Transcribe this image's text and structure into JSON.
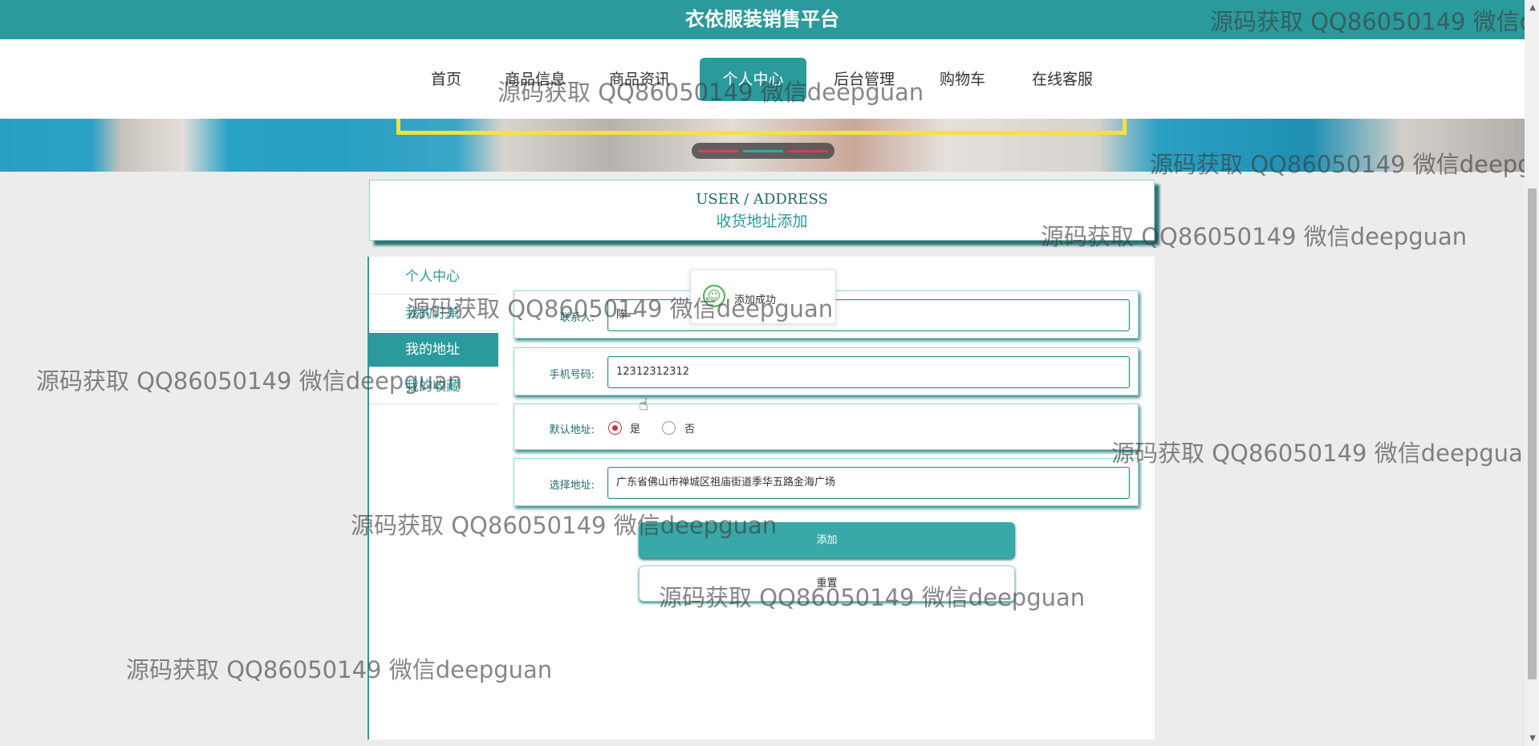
{
  "site": {
    "title": "衣依服装销售平台"
  },
  "nav": {
    "items": [
      {
        "label": "首页"
      },
      {
        "label": "商品信息"
      },
      {
        "label": "商品资讯"
      },
      {
        "label": "个人中心"
      },
      {
        "label": "后台管理"
      },
      {
        "label": "购物车"
      },
      {
        "label": "在线客服"
      }
    ],
    "active": "个人中心"
  },
  "page_header": {
    "title_en": "USER / ADDRESS",
    "title_cn": "收货地址添加"
  },
  "sidebar": {
    "items": [
      {
        "label": "个人中心"
      },
      {
        "label": "我的订单"
      },
      {
        "label": "我的地址"
      },
      {
        "label": "我的收藏"
      }
    ],
    "active": "我的地址"
  },
  "form": {
    "contact": {
      "label": "联系人:",
      "value": "陈一"
    },
    "phone": {
      "label": "手机号码:",
      "value": "12312312312"
    },
    "default": {
      "label": "默认地址:",
      "options": [
        "是",
        "否"
      ],
      "selected": "是"
    },
    "address": {
      "label": "选择地址:",
      "value": "广东省佛山市禅城区祖庙街道季华五路金海广场"
    },
    "submit_label": "添加",
    "reset_label": "重置"
  },
  "toast": {
    "message": "添加成功"
  },
  "watermark": {
    "text": "源码获取 QQ86050149 微信deepguan"
  },
  "colors": {
    "primary": "#2b9a9c",
    "accent": "#c2343f",
    "banner_frame": "#f3e33a"
  }
}
